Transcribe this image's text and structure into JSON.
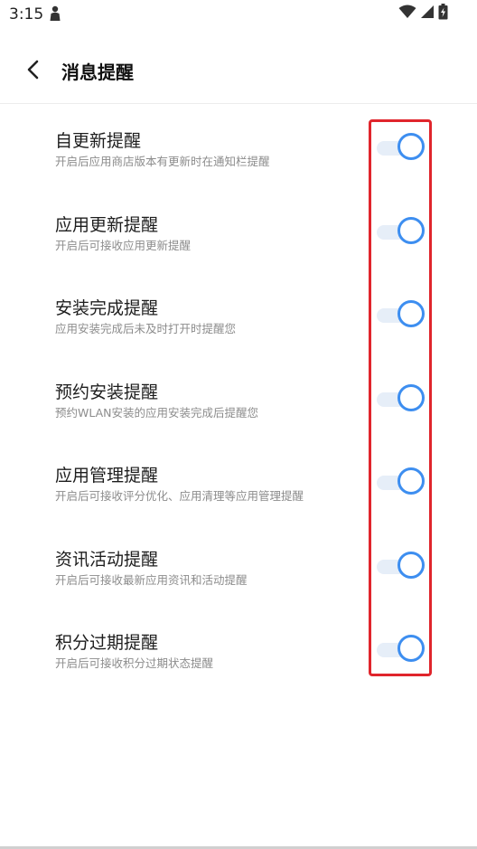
{
  "status_bar": {
    "time": "3:15"
  },
  "header": {
    "title": "消息提醒"
  },
  "settings": [
    {
      "title": "自更新提醒",
      "description": "开启后应用商店版本有更新时在通知栏提醒",
      "enabled": true
    },
    {
      "title": "应用更新提醒",
      "description": "开启后可接收应用更新提醒",
      "enabled": true
    },
    {
      "title": "安装完成提醒",
      "description": "应用安装完成后未及时打开时提醒您",
      "enabled": true
    },
    {
      "title": "预约安装提醒",
      "description": "预约WLAN安装的应用安装完成后提醒您",
      "enabled": true
    },
    {
      "title": "应用管理提醒",
      "description": "开启后可接收评分优化、应用清理等应用管理提醒",
      "enabled": true
    },
    {
      "title": "资讯活动提醒",
      "description": "开启后可接收最新应用资讯和活动提醒",
      "enabled": true
    },
    {
      "title": "积分过期提醒",
      "description": "开启后可接收积分过期状态提醒",
      "enabled": true
    }
  ],
  "colors": {
    "accent": "#3d8ef0",
    "highlight": "#e0252c"
  }
}
